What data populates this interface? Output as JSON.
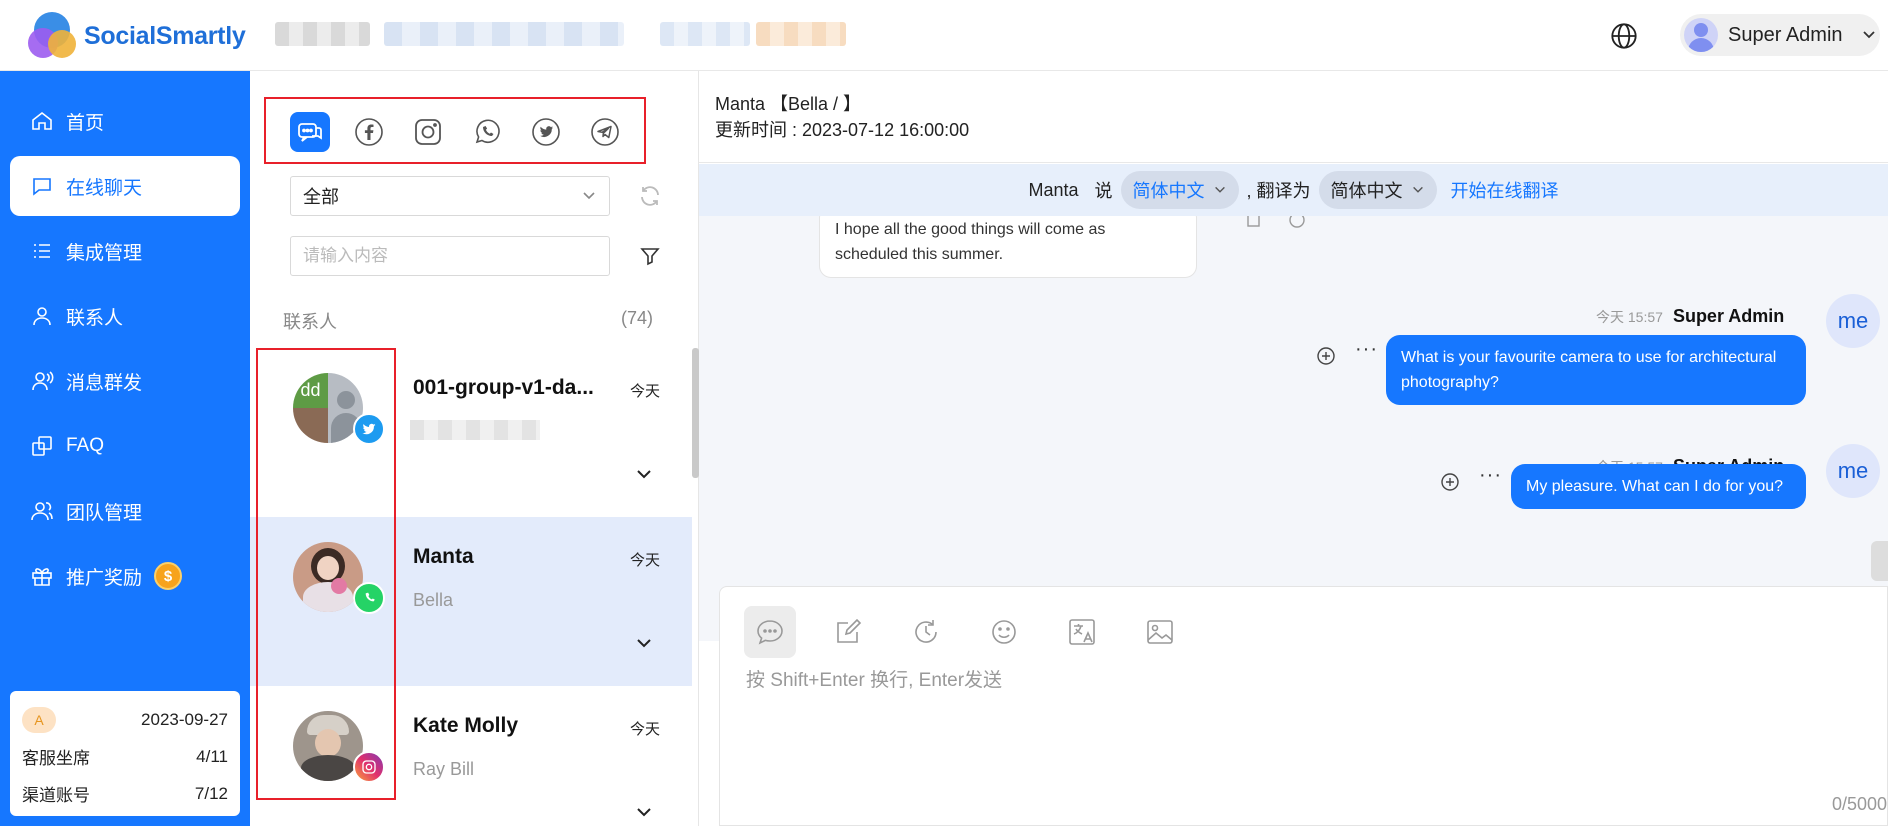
{
  "app": {
    "name": "SocialSmartly"
  },
  "topbar": {
    "user_name": "Super Admin"
  },
  "sidebar": {
    "items": [
      {
        "label": "首页",
        "icon": "home-icon"
      },
      {
        "label": "在线聊天",
        "icon": "chat-icon",
        "active": true
      },
      {
        "label": "集成管理",
        "icon": "list-icon"
      },
      {
        "label": "联系人",
        "icon": "user-icon"
      },
      {
        "label": "消息群发",
        "icon": "broadcast-icon"
      },
      {
        "label": "FAQ",
        "icon": "copy-icon"
      },
      {
        "label": "团队管理",
        "icon": "team-icon"
      },
      {
        "label": "推广奖励",
        "icon": "gift-icon"
      }
    ],
    "reward_coin": "$",
    "stats": {
      "badge": "A",
      "date": "2023-09-27",
      "seats_label": "客服坐席",
      "seats_value": "4/11",
      "channels_label": "渠道账号",
      "channels_value": "7/12"
    }
  },
  "contacts_panel": {
    "channels": [
      "all-chats",
      "facebook",
      "instagram",
      "whatsapp",
      "twitter",
      "telegram"
    ],
    "filter_value": "全部",
    "search_placeholder": "请输入内容",
    "list_title": "联系人",
    "list_count": "(74)",
    "contacts": [
      {
        "name": "001-group-v1-da...",
        "time": "今天",
        "subtitle": "",
        "channel": "twitter",
        "avatar_text": "dd"
      },
      {
        "name": "Manta",
        "time": "今天",
        "subtitle": "Bella",
        "channel": "whatsapp",
        "selected": true
      },
      {
        "name": "Kate Molly",
        "time": "今天",
        "subtitle": "Ray Bill",
        "channel": "instagram"
      }
    ]
  },
  "chat": {
    "header_title": "Manta 【Bella / 】",
    "updated_label": "更新时间 : 2023-07-12 16:00:00",
    "translate": {
      "speaker": "Manta",
      "says": "说",
      "source_lang": "简体中文",
      "translate_to": ", 翻译为",
      "target_lang": "简体中文",
      "start_link": "开始在线翻译"
    },
    "incoming_partial": "I hope all the good things will come as scheduled this summer.",
    "messages": [
      {
        "time": "今天 15:57",
        "sender": "Super Admin",
        "avatar": "me",
        "text": "What is your favourite camera to use for architectural photography?"
      },
      {
        "time": "今天 15:57",
        "sender": "Super Admin",
        "avatar": "me",
        "text": "My pleasure. What can I do for you?"
      }
    ],
    "composer": {
      "placeholder": "按 Shift+Enter 换行, Enter发送",
      "counter": "0/5000"
    }
  },
  "colors": {
    "primary": "#1677ff",
    "highlight": "#e8202a"
  }
}
